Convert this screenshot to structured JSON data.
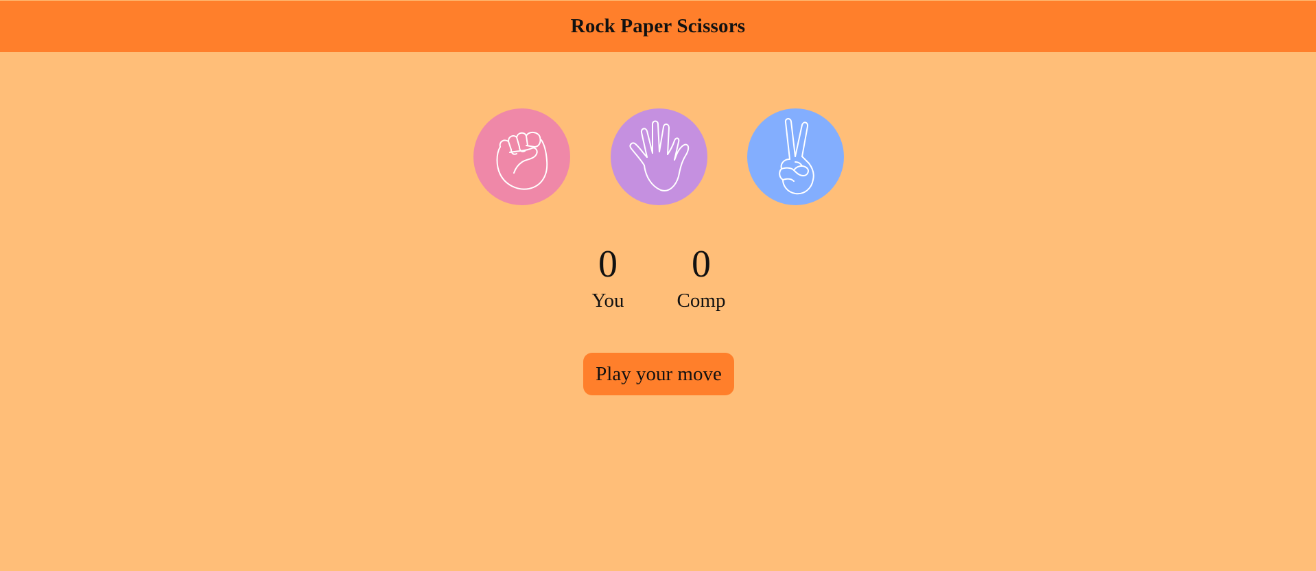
{
  "header": {
    "title": "Rock Paper Scissors"
  },
  "choices": [
    {
      "id": "rock",
      "icon": "fist-icon",
      "color": "#ef88a8"
    },
    {
      "id": "paper",
      "icon": "open-hand-icon",
      "color": "#c590e0"
    },
    {
      "id": "scissors",
      "icon": "peace-hand-icon",
      "color": "#83aefe"
    }
  ],
  "scoreboard": {
    "user": {
      "score": "0",
      "label": "You"
    },
    "computer": {
      "score": "0",
      "label": "Comp"
    }
  },
  "message": {
    "text": "Play your move"
  },
  "colors": {
    "background": "#ffbe78",
    "accent": "#ff7f2b"
  }
}
